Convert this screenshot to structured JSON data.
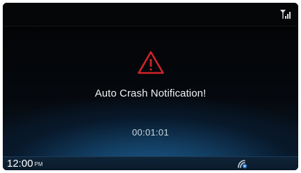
{
  "status": {
    "signal_icon": "signal-strength-icon"
  },
  "alert": {
    "icon": "warning-triangle-icon",
    "title": "Auto Crash Notification!",
    "timer": "00:01:01",
    "accent_color": "#d0232a"
  },
  "footer": {
    "time": "12:00",
    "ampm": "PM",
    "status_icon": "phone-connection-icon"
  }
}
